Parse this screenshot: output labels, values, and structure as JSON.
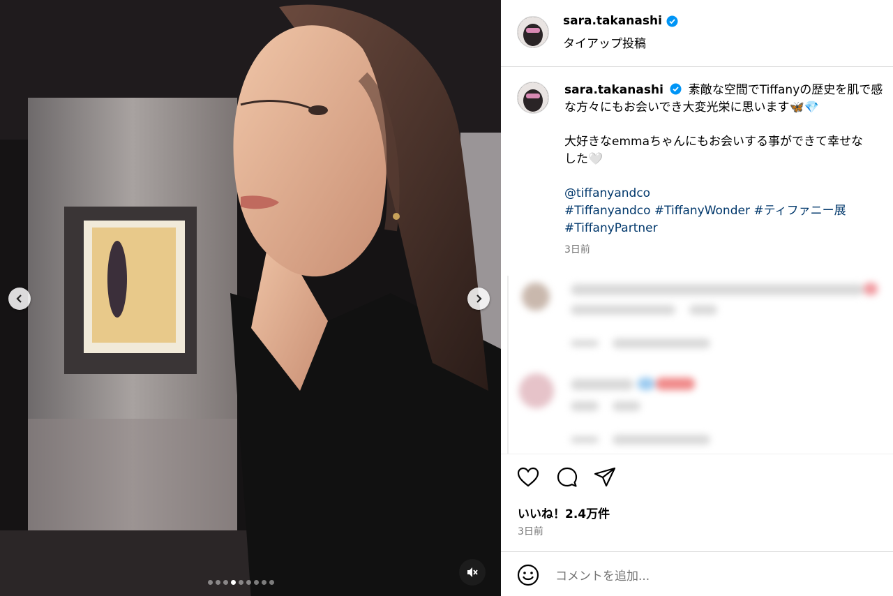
{
  "post": {
    "username": "sara.takanashi",
    "header_sub": "タイアップ投稿",
    "caption_lines": [
      "素敵な空間でTiffanyの歴史を肌で感",
      "な方々にもお会いでき大変光栄に思います🦋💎",
      "大好きなemmaちゃんにもお会いする事ができて幸せな",
      "した🤍"
    ],
    "mention": "@tiffanyandco",
    "hashtags_line1": "#Tiffanyandco #TiffanyWonder #ティファニー展",
    "hashtags_line2": "#TiffanyPartner",
    "caption_time": "3日前",
    "likes": "いいね！2.4万件",
    "post_time": "3日前",
    "comment_placeholder": "コメントを追加..."
  },
  "media": {
    "slide_count": 9,
    "active_slide": 4
  },
  "icons": {
    "verified": "verified-badge-icon",
    "like": "heart-icon",
    "comment": "comment-icon",
    "share": "share-icon",
    "emoji": "emoji-icon",
    "mute": "muted-speaker-icon",
    "prev": "chevron-left-icon",
    "next": "chevron-right-icon"
  },
  "colors": {
    "verified": "#0095f6",
    "link": "#00376b",
    "meta_text": "#737373"
  }
}
